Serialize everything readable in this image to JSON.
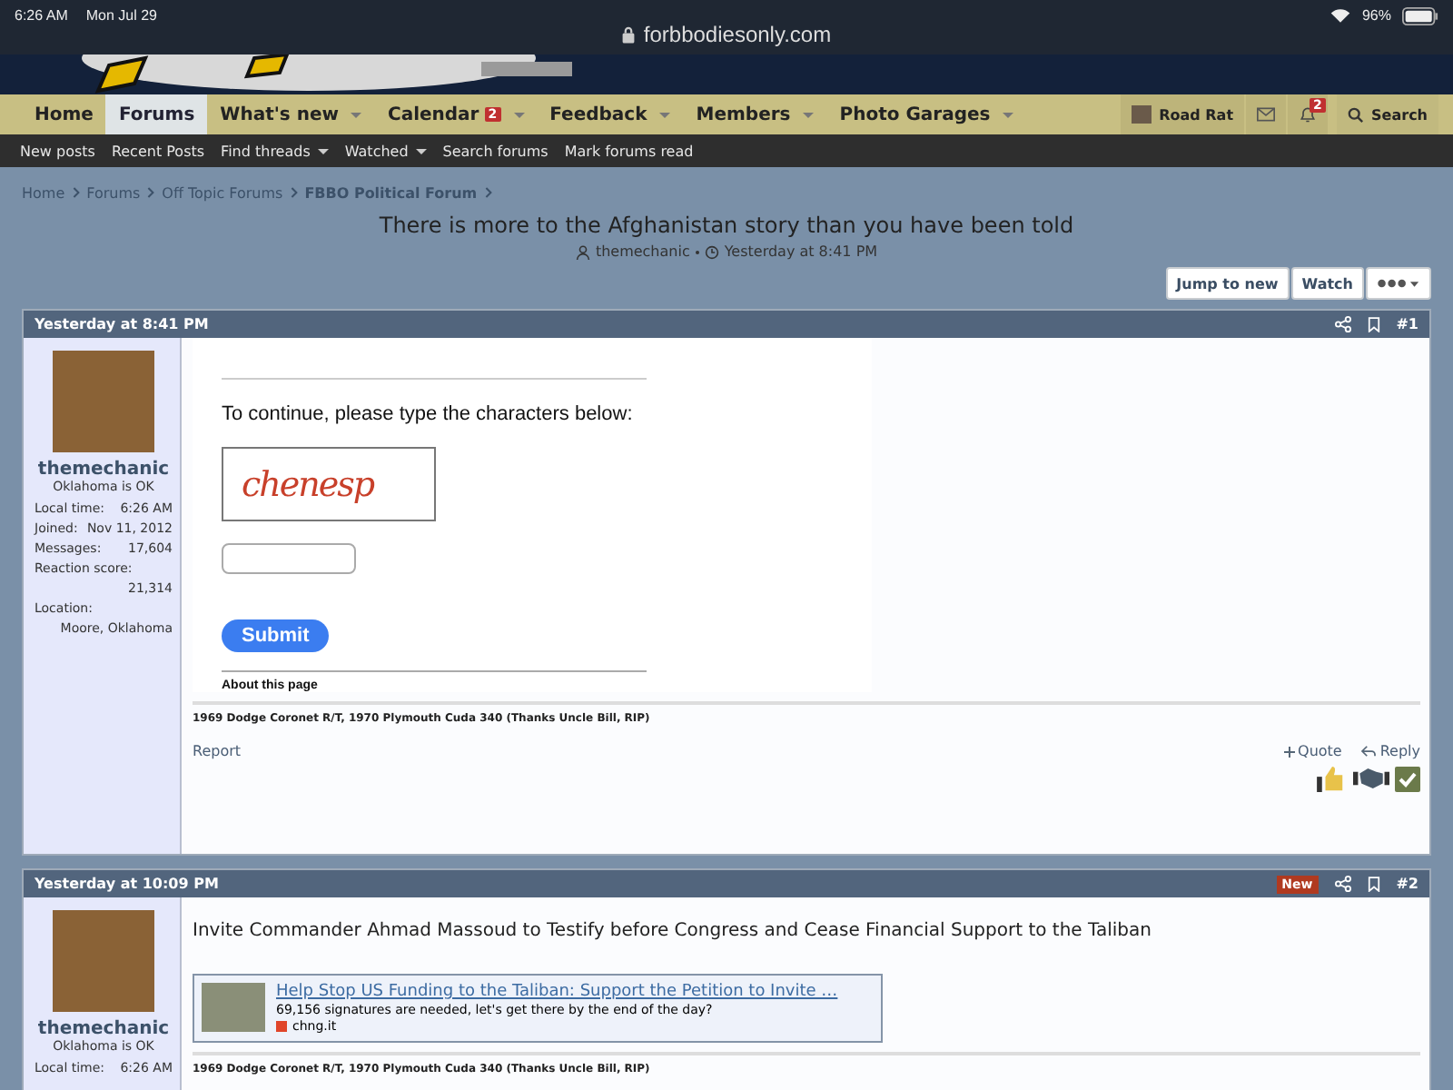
{
  "status_bar": {
    "time": "6:26 AM",
    "date": "Mon Jul 29",
    "url": "forbbodiesonly.com",
    "battery": "96%"
  },
  "nav": {
    "tabs": [
      {
        "label": "Home",
        "selected": false,
        "menu": false
      },
      {
        "label": "Forums",
        "selected": true,
        "menu": false
      },
      {
        "label": "What's new",
        "selected": false,
        "menu": true
      },
      {
        "label": "Calendar",
        "selected": false,
        "menu": true,
        "badge": "2"
      },
      {
        "label": "Feedback",
        "selected": false,
        "menu": true
      },
      {
        "label": "Members",
        "selected": false,
        "menu": true
      },
      {
        "label": "Photo Garages",
        "selected": false,
        "menu": true
      }
    ],
    "account": "Road Rat",
    "alerts_badge": "2",
    "search": "Search"
  },
  "subnav": [
    {
      "label": "New posts",
      "menu": false
    },
    {
      "label": "Recent Posts",
      "menu": false
    },
    {
      "label": "Find threads",
      "menu": true
    },
    {
      "label": "Watched",
      "menu": true
    },
    {
      "label": "Search forums",
      "menu": false
    },
    {
      "label": "Mark forums read",
      "menu": false
    }
  ],
  "breadcrumbs": [
    {
      "label": "Home",
      "current": false
    },
    {
      "label": "Forums",
      "current": false
    },
    {
      "label": "Off Topic Forums",
      "current": false
    },
    {
      "label": "FBBO Political Forum",
      "current": true
    }
  ],
  "thread": {
    "title": "There is more to the Afghanistan story than you have been told",
    "author": "themechanic",
    "time": "Yesterday at 8:41 PM"
  },
  "thread_buttons": [
    "Jump to new",
    "Watch"
  ],
  "posts": [
    {
      "time": "Yesterday at 8:41 PM",
      "new": false,
      "number": "#1",
      "user": {
        "name": "themechanic",
        "title": "Oklahoma is OK",
        "stats": [
          {
            "label": "Local time:",
            "value": "6:26 AM"
          },
          {
            "label": "Joined:",
            "value": "Nov 11, 2012"
          },
          {
            "label": "Messages:",
            "value": "17,604"
          },
          {
            "label": "Reaction score:",
            "value": "21,314"
          },
          {
            "label": "Location:",
            "value": "Moore, Oklahoma"
          }
        ]
      },
      "kind": "captcha",
      "prompt": "To continue, please type the characters below:",
      "captcha_text": "chenesp",
      "submit": "Submit",
      "about": "About this page",
      "signature": "1969 Dodge Coronet R/T, 1970 Plymouth Cuda 340 (Thanks Uncle Bill, RIP)",
      "report": "Report",
      "quote": "Quote",
      "reply": "Reply",
      "reactions": true
    },
    {
      "time": "Yesterday at 10:09 PM",
      "new": true,
      "new_label": "New",
      "number": "#2",
      "user": {
        "name": "themechanic",
        "title": "Oklahoma is OK",
        "stats": [
          {
            "label": "Local time:",
            "value": "6:26 AM"
          }
        ]
      },
      "kind": "link",
      "text": "Invite Commander Ahmad Massoud to Testify before Congress and Cease Financial Support to the Taliban",
      "link": {
        "title": "Help Stop US Funding to the Taliban: Support the Petition to Invite …",
        "description": "69,156 signatures are needed, let's get there by the end of the day?",
        "domain": "chng.it"
      },
      "signature": "1969 Dodge Coronet R/T, 1970 Plymouth Cuda 340 (Thanks Uncle Bill, RIP)",
      "reactions": false
    }
  ]
}
